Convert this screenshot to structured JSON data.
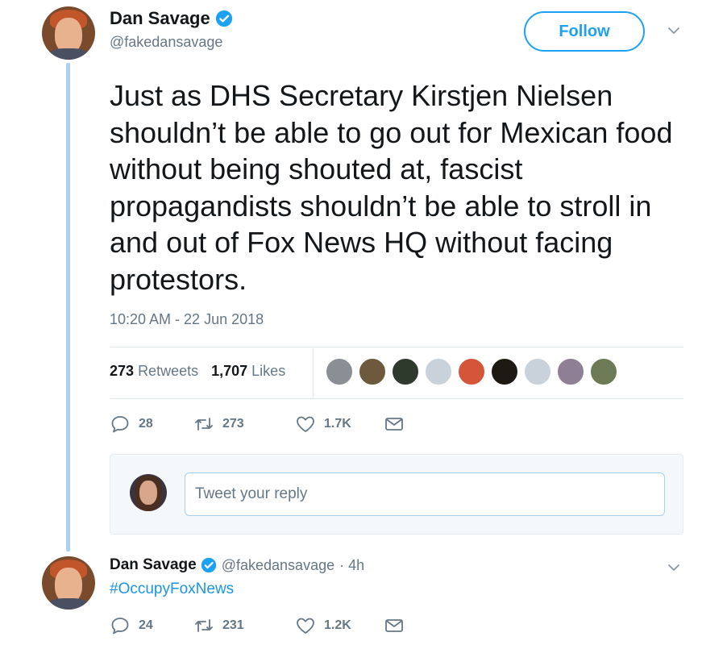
{
  "tweet": {
    "author_name": "Dan Savage",
    "author_handle": "@fakedansavage",
    "follow_label": "Follow",
    "text": "Just as DHS Secretary Kirstjen Nielsen shouldn’t be able to go out for Mexican food without being shouted at, fascist propagandists shouldn’t be able to stroll in and out of Fox News HQ without facing protestors.",
    "timestamp": "10:20 AM - 22 Jun 2018",
    "retweets_count": "273",
    "retweets_label": "Retweets",
    "likes_count": "1,707",
    "likes_label": "Likes",
    "actions": {
      "replies": "28",
      "retweets": "273",
      "likes": "1.7K"
    }
  },
  "reply": {
    "placeholder": "Tweet your reply"
  },
  "reply_tweet": {
    "author_name": "Dan Savage",
    "author_handle": "@fakedansavage",
    "time": "· 4h",
    "text": "#OccupyFoxNews",
    "actions": {
      "replies": "24",
      "retweets": "231",
      "likes": "1.2K"
    }
  },
  "liker_colors": [
    "#8a8f96",
    "#6d5a3c",
    "#2d3a2c",
    "#c9d2da",
    "#d4553a",
    "#1d1a14",
    "#c9d2da",
    "#8e7f95",
    "#6c7a55"
  ],
  "colors": {
    "accent": "#1da1f2",
    "text": "#14171a",
    "secondary": "#657786",
    "thread_line": "#a7d1ef"
  }
}
